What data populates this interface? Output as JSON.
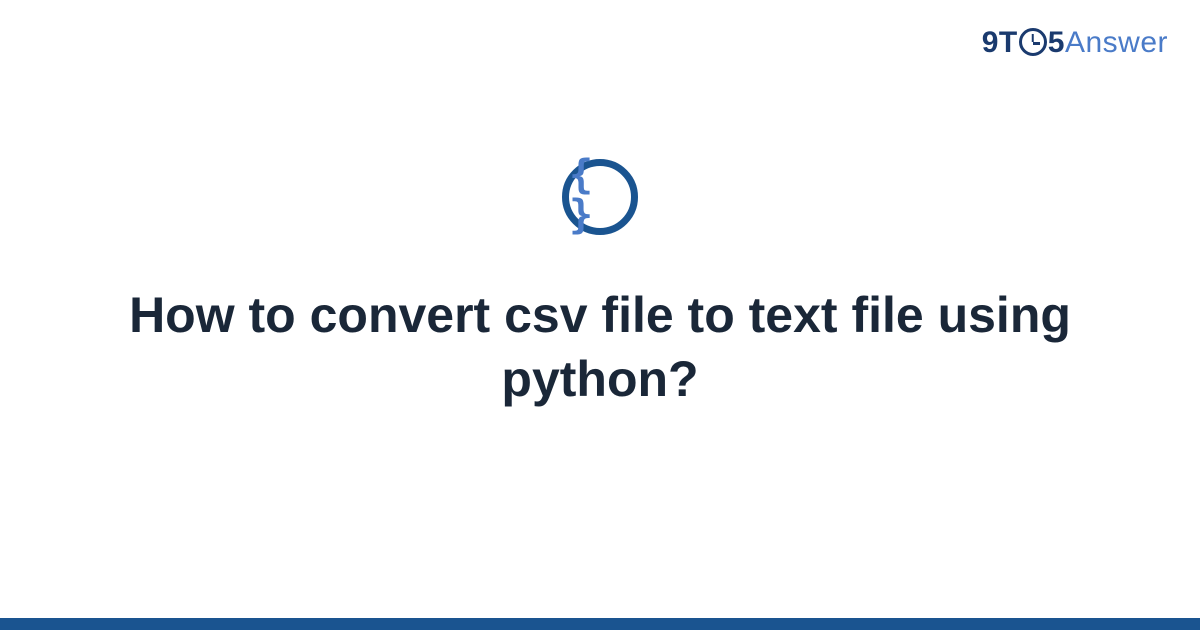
{
  "logo": {
    "part1": "9T",
    "part2": "5",
    "part3": "Answer"
  },
  "icon": {
    "glyph": "{ }"
  },
  "title": "How to convert csv file to text file using python?",
  "colors": {
    "brand_dark": "#1a3a6e",
    "brand_light": "#4a7bc8",
    "icon_ring": "#1a5490",
    "text": "#1a2738",
    "bar": "#1a5490"
  }
}
